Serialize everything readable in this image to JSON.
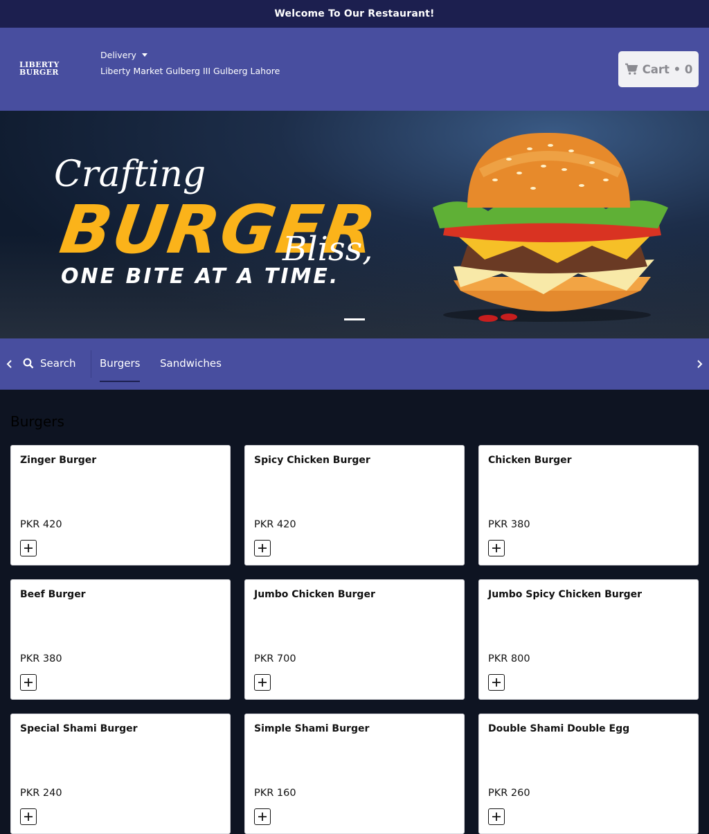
{
  "topbar": {
    "welcome": "Welcome To Our Restaurant!"
  },
  "header": {
    "logo_line1": "LIBERTY",
    "logo_line2": "BURGER",
    "delivery_label": "Delivery",
    "address": "Liberty Market Gulberg III Gulberg Lahore",
    "cart_label": "Cart • 0"
  },
  "banner": {
    "crafting": "Crafting",
    "burger": "BURGER",
    "bliss": "Bliss,",
    "tagline": "ONE BITE AT A TIME."
  },
  "categories": {
    "search_label": "Search",
    "tabs": [
      "Burgers",
      "Sandwiches"
    ],
    "active_tab": "Burgers"
  },
  "section": {
    "title": "Burgers"
  },
  "menu": [
    {
      "name": "Zinger Burger",
      "price": "PKR 420"
    },
    {
      "name": "Spicy Chicken Burger",
      "price": "PKR 420"
    },
    {
      "name": "Chicken Burger",
      "price": "PKR 380"
    },
    {
      "name": "Beef Burger",
      "price": "PKR 380"
    },
    {
      "name": "Jumbo Chicken Burger",
      "price": "PKR 700"
    },
    {
      "name": "Jumbo Spicy Chicken Burger",
      "price": "PKR 800"
    },
    {
      "name": "Special Shami Burger",
      "price": "PKR 240"
    },
    {
      "name": "Simple Shami Burger",
      "price": "PKR 160"
    },
    {
      "name": "Double Shami Double Egg",
      "price": "PKR 260"
    }
  ],
  "colors": {
    "topbar": "#1c1f4f",
    "header": "#484e9f",
    "accent": "#fbb31a",
    "page": "#0e1422"
  }
}
